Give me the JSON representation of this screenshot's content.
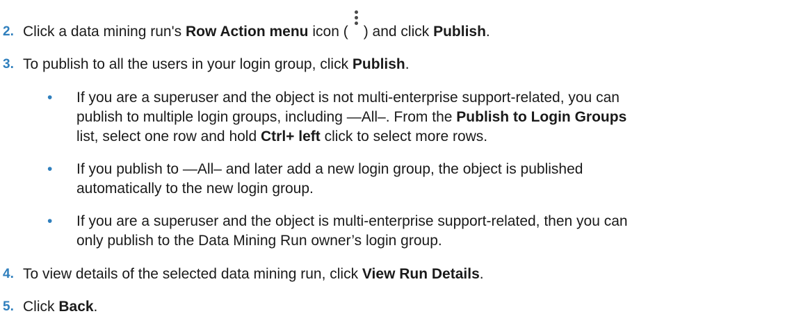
{
  "steps": [
    {
      "num": "2.",
      "parts": {
        "a": "Click a data mining run's ",
        "b": "Row Action menu",
        "c": " icon (",
        "d": ") and click ",
        "e": "Publish",
        "f": "."
      },
      "icon": "kebab-vertical-icon"
    },
    {
      "num": "3.",
      "parts": {
        "a": "To publish to all the users in your login group, click ",
        "b": "Publish",
        "c": "."
      }
    },
    {
      "num": "4.",
      "parts": {
        "a": "To view details of the selected data mining run, click ",
        "b": "View Run Details",
        "c": "."
      }
    },
    {
      "num": "5.",
      "parts": {
        "a": "Click ",
        "b": "Back",
        "c": "."
      }
    }
  ],
  "bullets": [
    {
      "dot": "•",
      "line1": "If you are a superuser and the object is not multi-enterprise support-related, you can",
      "line2a": "publish to multiple login groups, including —All–. From the ",
      "line2b": "Publish to Login Groups",
      "line3a": "list, select one row and hold ",
      "line3b": "Ctrl+ left",
      "line3c": " click to select more rows."
    },
    {
      "dot": "•",
      "line1": "If you publish to —All– and later add a new login group, the object is published",
      "line2": "automatically to the new login group."
    },
    {
      "dot": "•",
      "line1": "If you are a superuser and the object is multi-enterprise support-related, then you can",
      "line2": "only publish to the Data Mining Run owner’s login group."
    }
  ]
}
